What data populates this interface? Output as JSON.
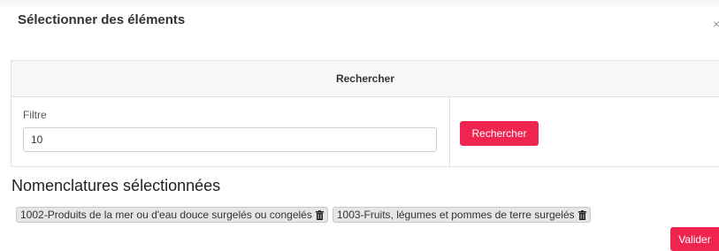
{
  "modal": {
    "title": "Sélectionner des éléments",
    "close_label": "×"
  },
  "search_panel": {
    "heading": "Rechercher",
    "filter_label": "Filtre",
    "filter_value": "10",
    "search_button_label": "Rechercher"
  },
  "selected_section": {
    "title": "Nomenclatures sélectionnées",
    "chips": [
      {
        "label": "1002-Produits de la mer ou d'eau douce surgelés ou congelés",
        "icon": "trash-icon"
      },
      {
        "label": "1003-Fruits, légumes et pommes de terre surgelés",
        "icon": "trash-icon"
      }
    ]
  },
  "footer": {
    "validate_button_label": "Valider"
  },
  "colors": {
    "accent": "#f0254f",
    "chip_bg": "#e6e6e6",
    "panel_head_bg": "#f7f7f7"
  }
}
